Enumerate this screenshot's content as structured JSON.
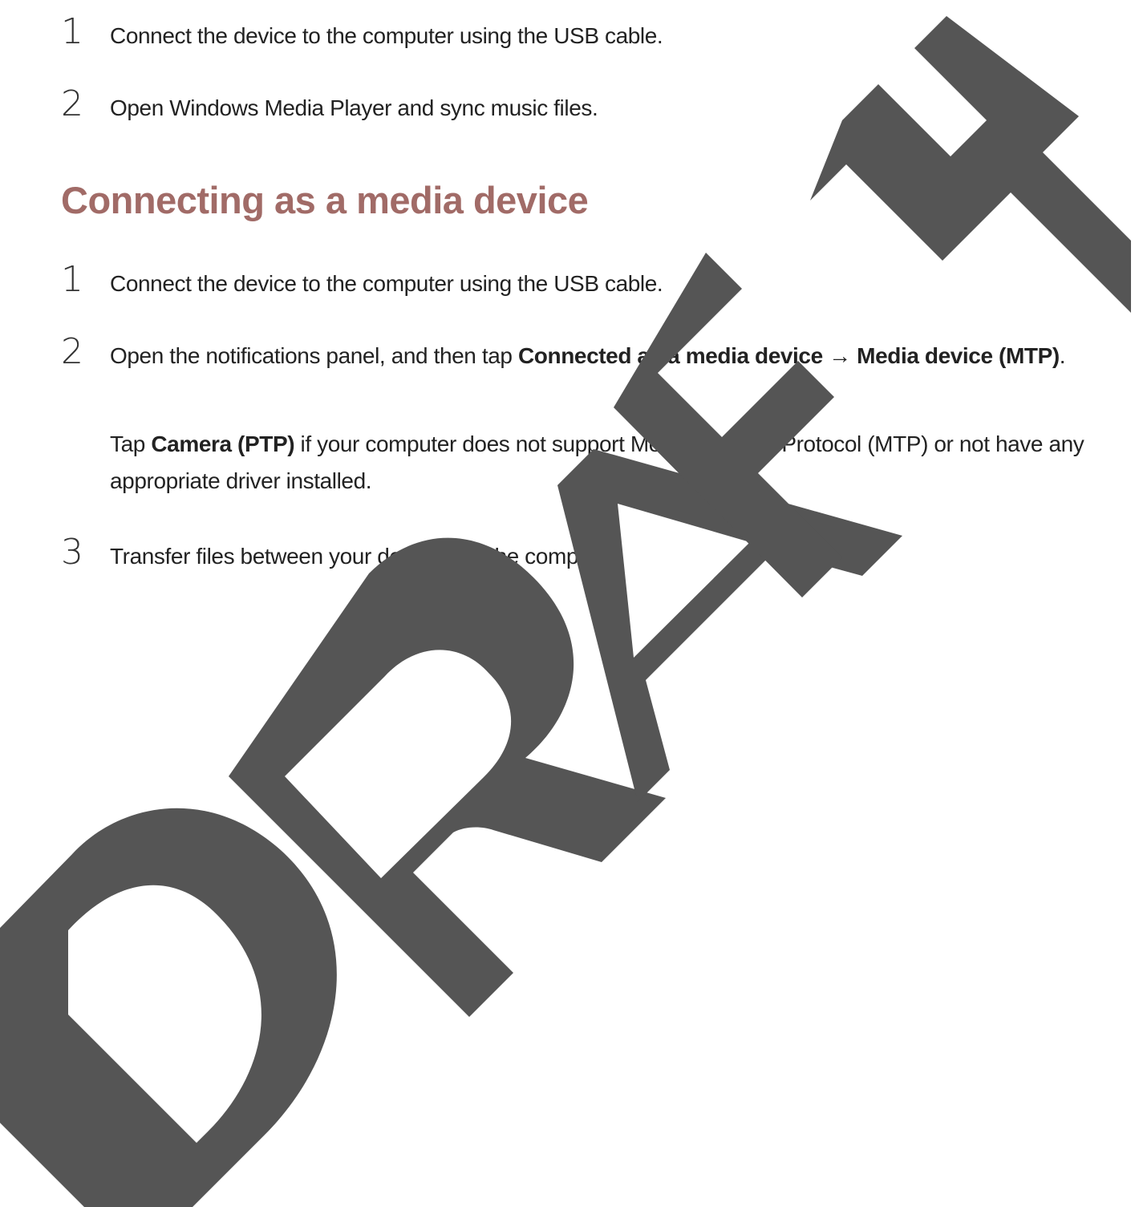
{
  "top_steps": [
    {
      "number": "1",
      "text": "Connect the device to the computer using the USB cable."
    },
    {
      "number": "2",
      "text": "Open Windows Media Player and sync music files."
    }
  ],
  "section": {
    "heading": "Connecting as a media device",
    "steps": [
      {
        "number": "1",
        "text": "Connect the device to the computer using the USB cable."
      },
      {
        "number": "2",
        "text_before": "Open the notifications panel, and then tap ",
        "bold_1": "Connected as a media device",
        "arrow": " → ",
        "bold_2": "Media device (MTP)",
        "text_after": "."
      },
      {
        "number": "3",
        "text": "Transfer files between your device and the computer."
      }
    ],
    "note": {
      "text_before": "Tap ",
      "bold": "Camera (PTP)",
      "text_after": " if your computer does not support Media Transfer Protocol (MTP) or not have any appropriate driver installed."
    }
  },
  "watermark": {
    "text": "DRAFT",
    "color": "#555555"
  }
}
